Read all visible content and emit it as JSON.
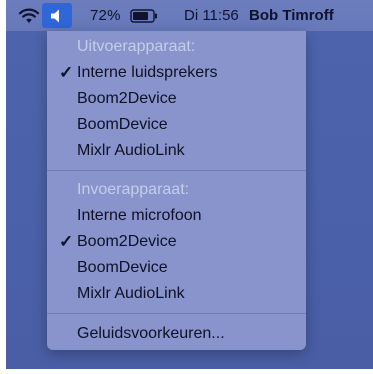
{
  "menubar": {
    "battery_percent": "72%",
    "clock": "Di 11:56",
    "user": "Bob Timroff"
  },
  "menu": {
    "output_header": "Uitvoerapparaat:",
    "output_items": [
      {
        "label": "Interne luidsprekers",
        "checked": true
      },
      {
        "label": "Boom2Device",
        "checked": false
      },
      {
        "label": "BoomDevice",
        "checked": false
      },
      {
        "label": "Mixlr AudioLink",
        "checked": false
      }
    ],
    "input_header": "Invoerapparaat:",
    "input_items": [
      {
        "label": "Interne microfoon",
        "checked": false
      },
      {
        "label": "Boom2Device",
        "checked": true
      },
      {
        "label": "BoomDevice",
        "checked": false
      },
      {
        "label": "Mixlr AudioLink",
        "checked": false
      }
    ],
    "preferences": "Geluidsvoorkeuren...",
    "checkmark": "✓"
  },
  "icons": {
    "wifi": "wifi-icon",
    "sound": "speaker-icon",
    "battery": "battery-icon"
  },
  "colors": {
    "selection_highlight": "#2f66d8",
    "menu_background": "#8d98cd",
    "header_text": "#c6cde9"
  }
}
